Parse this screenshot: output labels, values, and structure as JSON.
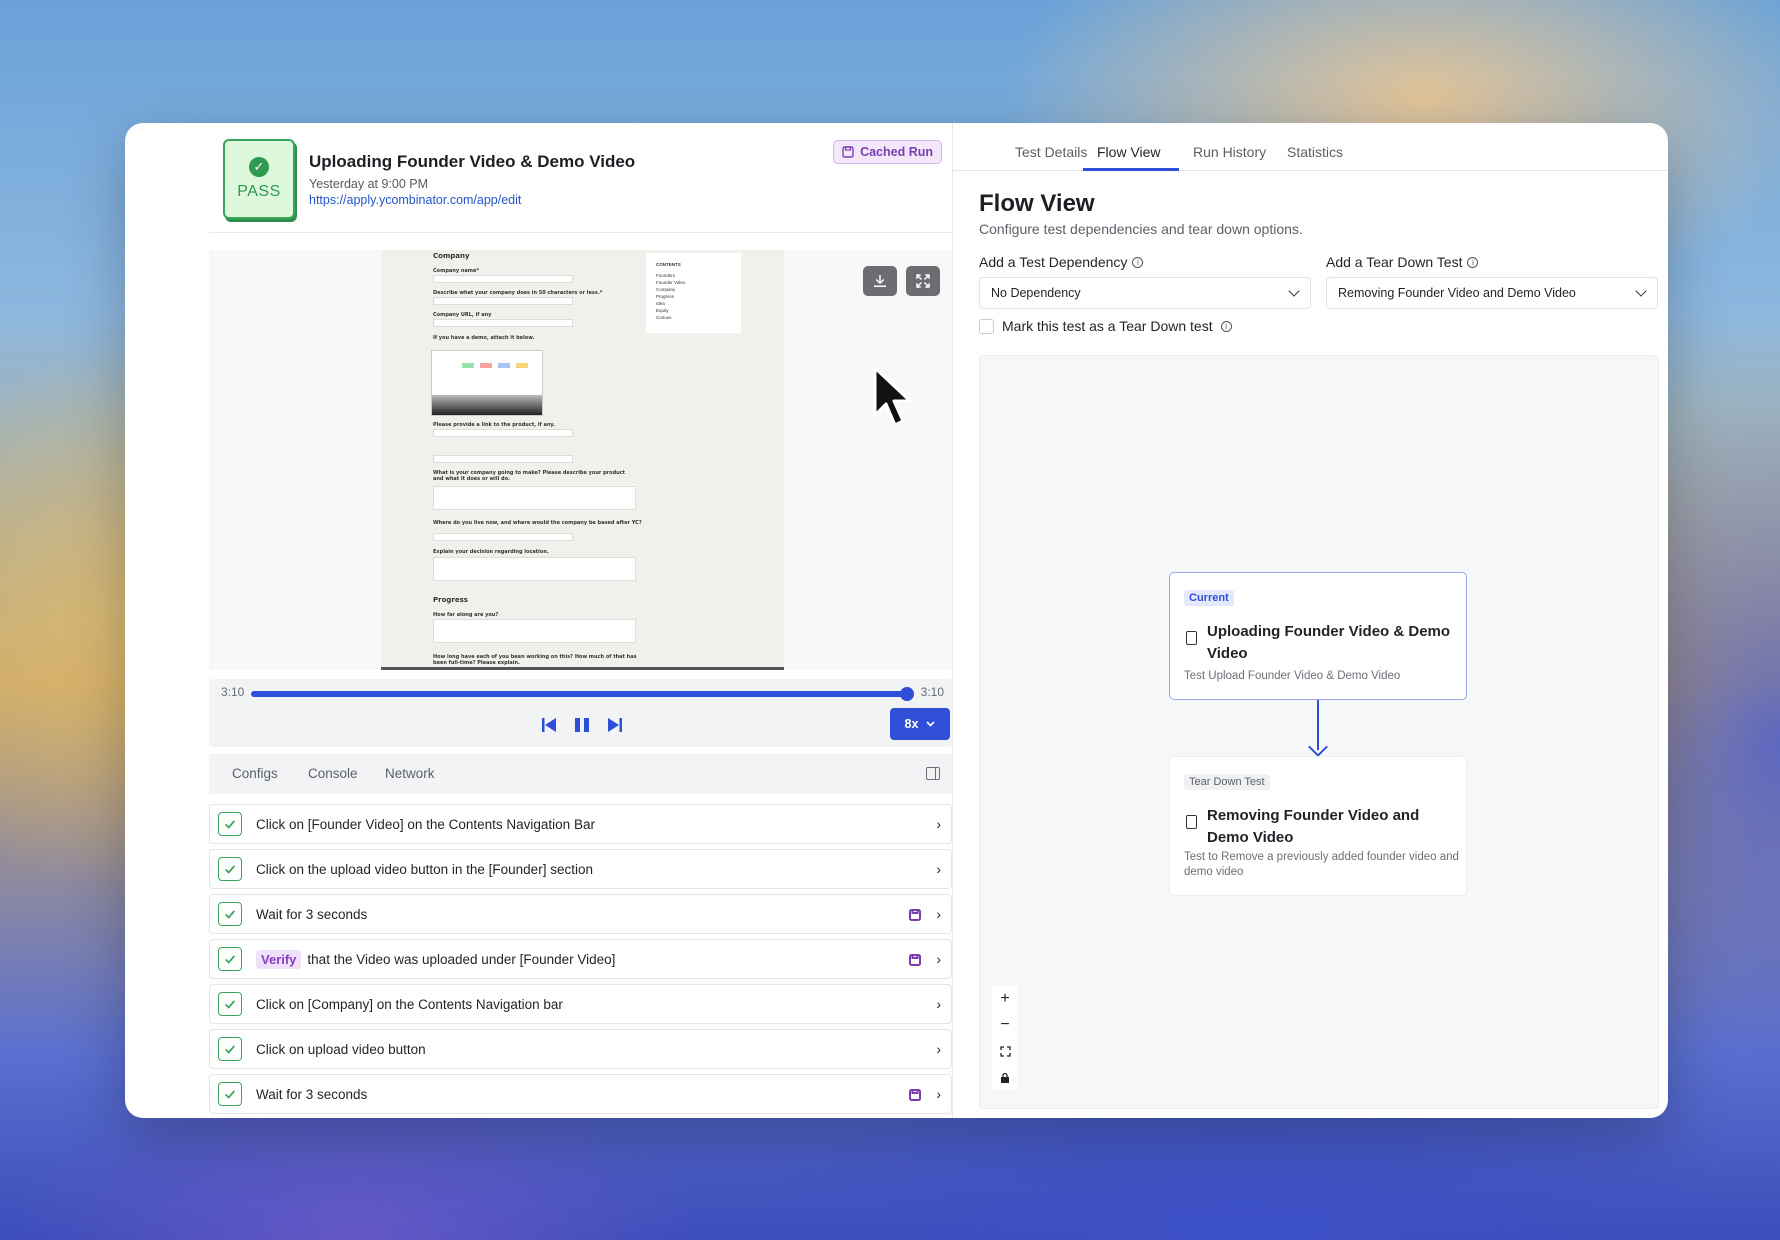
{
  "run": {
    "status": "PASS",
    "title": "Uploading Founder Video & Demo Video",
    "time": "Yesterday at 9:00 PM",
    "url": "https://apply.ycombinator.com/app/edit",
    "cached_label": "Cached Run"
  },
  "preview": {
    "section_company": "Company",
    "company_name": "Company name*",
    "describe": "Describe what your company does in 50 characters or less.*",
    "company_url": "Company URL, if any",
    "demo": "If you have a demo, attach it below.",
    "product_link": "Please provide a link to the product, if any.",
    "making": "What is your company going to make? Please describe your product and what it does or will do.",
    "where": "Where do you live now, and where would the company be based after YC?",
    "explain": "Explain your decision regarding location.",
    "section_progress": "Progress",
    "how_far": "How far along are you?",
    "how_long": "How long have each of you been working on this? How much of that has been full-time? Please explain.",
    "contents_title": "CONTENTS",
    "contents_items": [
      "Founders",
      "Founder Video",
      "Company",
      "Progress",
      "Idea",
      "Equity",
      "Curious"
    ]
  },
  "player": {
    "current_time": "3:10",
    "total_time": "3:10",
    "progress": 1.0,
    "speed": "8x"
  },
  "subtabs": [
    "Configs",
    "Console",
    "Network"
  ],
  "steps": [
    {
      "text": "Click on [Founder Video] on the Contents Navigation Bar",
      "cached": false
    },
    {
      "text": "Click on the upload video button in the [Founder] section",
      "cached": false
    },
    {
      "text": "Wait for 3 seconds",
      "cached": true
    },
    {
      "tag": "Verify",
      "text": "that the Video was uploaded under [Founder Video]",
      "cached": true
    },
    {
      "text": "Click on [Company] on the Contents Navigation bar",
      "cached": false
    },
    {
      "text": "Click on upload video button",
      "cached": false
    },
    {
      "text": "Wait for 3 seconds",
      "cached": true
    }
  ],
  "tabs": [
    "Test Details",
    "Flow View",
    "Run History",
    "Statistics"
  ],
  "active_tab": "Flow View",
  "flow": {
    "title": "Flow View",
    "subtitle": "Configure test dependencies and tear down options.",
    "dependency_label": "Add a Test Dependency",
    "dependency_value": "No Dependency",
    "teardown_label": "Add a Tear Down Test",
    "teardown_value": "Removing Founder Video and Demo Video",
    "mark_label": "Mark this test as a Tear Down test",
    "mark_checked": false,
    "current_node": {
      "tag": "Current",
      "title": "Uploading Founder Video & Demo Video",
      "desc": "Test Upload Founder Video & Demo Video"
    },
    "teardown_node": {
      "tag": "Tear Down Test",
      "title": "Removing Founder Video and Demo Video",
      "desc": "Test to Remove a previously added founder video and demo video"
    }
  },
  "colors": {
    "accent": "#2f4fd8",
    "pass_green": "#2f9a52",
    "cached_purple": "#7a3db0"
  }
}
